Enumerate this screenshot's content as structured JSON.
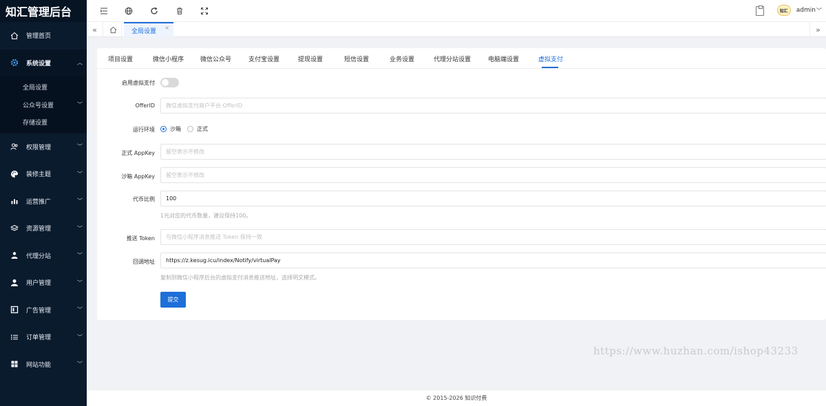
{
  "app": {
    "title": "知汇管理后台"
  },
  "sidebar": {
    "items": [
      {
        "label": "管理首页",
        "icon": "home-icon"
      },
      {
        "label": "系统设置",
        "icon": "gear-icon",
        "expanded": true
      },
      {
        "label": "权限管理",
        "icon": "users-icon"
      },
      {
        "label": "装修主题",
        "icon": "palette-icon"
      },
      {
        "label": "运营推广",
        "icon": "chart-icon"
      },
      {
        "label": "资源管理",
        "icon": "layers-icon"
      },
      {
        "label": "代理分站",
        "icon": "agent-icon"
      },
      {
        "label": "用户管理",
        "icon": "user-icon"
      },
      {
        "label": "广告管理",
        "icon": "ad-icon"
      },
      {
        "label": "订单管理",
        "icon": "list-icon"
      },
      {
        "label": "网站功能",
        "icon": "grid-icon"
      }
    ],
    "submenu": [
      {
        "label": "全局设置"
      },
      {
        "label": "公众号设置"
      },
      {
        "label": "存储设置"
      }
    ]
  },
  "header": {
    "admin_name": "admin",
    "avatar_text": "知汇"
  },
  "tabsbar": {
    "active_tab": "全局设置",
    "close": "×"
  },
  "form_tabs": [
    "项目设置",
    "微信小程序",
    "微信公众号",
    "支付宝设置",
    "提现设置",
    "短信设置",
    "业务设置",
    "代理分站设置",
    "电脑端设置",
    "虚拟支付"
  ],
  "form": {
    "enable_label": "启用虚拟支付",
    "offerid_label": "OfferID",
    "offerid_placeholder": "微信虚拟支付商户平台 OfferID",
    "env_label": "运行环境",
    "env_options": [
      "沙箱",
      "正式"
    ],
    "appkey_label": "正式 AppKey",
    "appkey_placeholder": "留空表示不修改",
    "sandbox_label": "沙箱 AppKey",
    "sandbox_placeholder": "留空表示不修改",
    "ratio_label": "代币比例",
    "ratio_value": "100",
    "ratio_hint": "1元对应的代币数量，建议保持100。",
    "token_label": "推送 Token",
    "token_placeholder": "与微信小程序消息推送 Token 保持一致",
    "callback_label": "回调地址",
    "callback_value": "https://z.kesug.icu/index/Notify/virtualPay",
    "callback_hint": "复制到微信小程序后台的虚拟支付消息推送地址，选择明文模式。",
    "submit": "提交"
  },
  "watermark": "https://www.huzhan.com/ishop43233",
  "footer": "© 2015-2026 知识付费"
}
